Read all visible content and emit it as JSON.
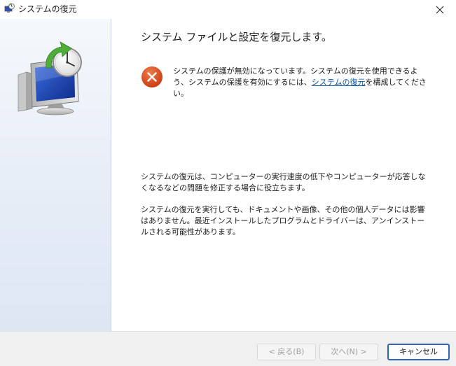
{
  "window": {
    "title": "システムの復元"
  },
  "content": {
    "heading": "システム ファイルと設定を復元します。",
    "error": {
      "text_before_link": "システムの保護が無効になっています。システムの復元を使用できるよう、システムの保護を有効にするには、",
      "link_text": "システムの復元",
      "text_after_link": "を構成してください。"
    },
    "paragraph1": "システムの復元は、コンピューターの実行速度の低下やコンピューターが応答しなくなるなどの問題を修正する場合に役立ちます。",
    "paragraph2": "システムの復元を実行しても、ドキュメントや画像、その他の個人データには影響はありません。最近インストールしたプログラムとドライバーは、アンインストールされる可能性があります。"
  },
  "footer": {
    "back_label": "< 戻る(B)",
    "next_label": "次へ(N) >",
    "cancel_label": "キャンセル"
  },
  "colors": {
    "error_red": "#d9491e",
    "link_blue": "#0b54a4",
    "focus_blue": "#2f66b8",
    "restore_green": "#4fae3a"
  }
}
